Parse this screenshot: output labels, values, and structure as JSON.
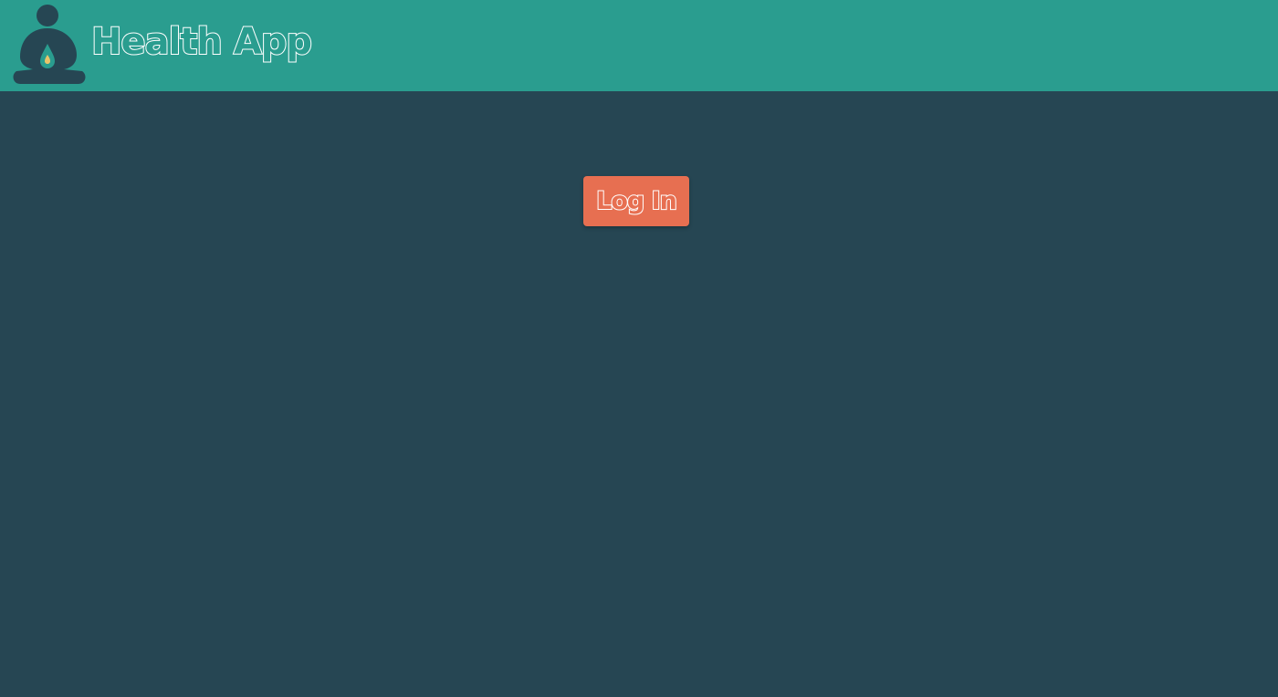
{
  "header": {
    "title": "Health App",
    "logo_icon": "meditation-figure-icon"
  },
  "main": {
    "login_label": "Log In"
  },
  "colors": {
    "header_bg": "#2a9d8f",
    "page_bg": "#264653",
    "button_bg": "#e76f51",
    "text_outline": "#ffffff",
    "logo_drop": "#e9c46a"
  }
}
